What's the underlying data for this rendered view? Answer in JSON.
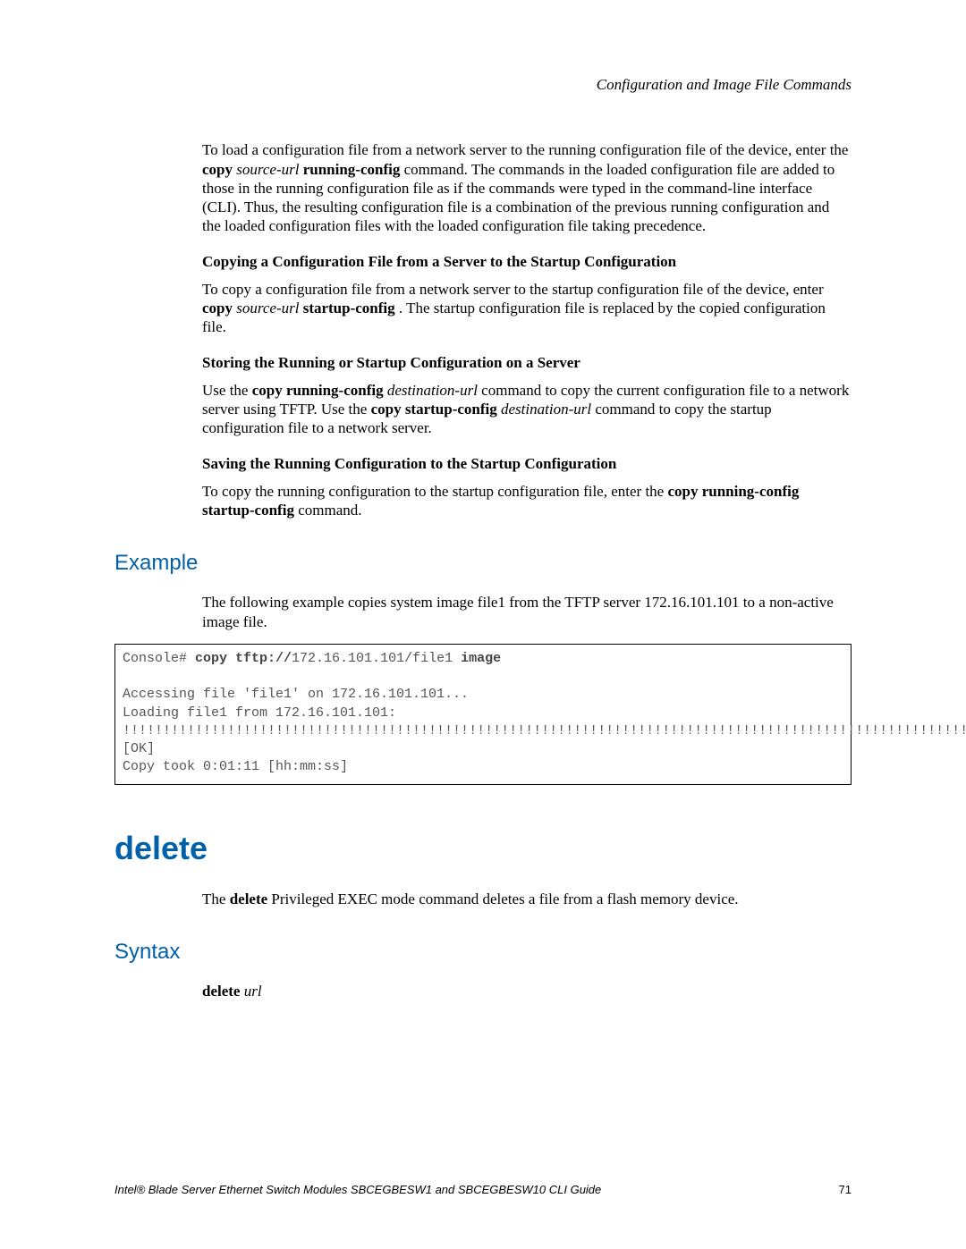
{
  "header": {
    "running_title": "Configuration and Image File Commands"
  },
  "intro_para": {
    "pre": "To load a configuration file from a network server to the running configuration file of the device, enter the ",
    "cmd_bold1": "copy",
    "cmd_ital": "source-url",
    "cmd_bold2": "running-config",
    "post": " command. The commands in the loaded configuration file are added to those in the running configuration file as if the commands were typed in the command-line interface (CLI). Thus, the resulting configuration file is a combination of the previous running configuration and the loaded configuration files with the loaded configuration file taking precedence."
  },
  "sec1": {
    "heading": "Copying a Configuration File from a Server to the Startup Configuration",
    "pre": "To copy a configuration file from a network server to the startup configuration file of the device, enter ",
    "cmd_bold1": "copy",
    "cmd_ital": "source-url",
    "cmd_bold2": "startup-config",
    "post": ". The startup configuration file is replaced by the copied configuration file."
  },
  "sec2": {
    "heading": "Storing the Running or Startup Configuration on a Server",
    "s1_pre": "Use the ",
    "s1_bold": "copy running-config",
    "s1_ital": "destination-url",
    "s1_mid": " command to copy the current configuration file to a network server using TFTP. Use the ",
    "s2_bold": "copy startup-config",
    "s2_ital": "destination-url",
    "s2_post": " command to copy the startup configuration file to a network server."
  },
  "sec3": {
    "heading": "Saving the Running Configuration to the Startup Configuration",
    "pre": "To copy the running configuration to the startup configuration file, enter the ",
    "bold": "copy running-config startup-config",
    "post": " command."
  },
  "example": {
    "heading": "Example",
    "para": "The following example copies system image file1 from the TFTP server 172.16.101.101 to a non-active image file.",
    "code_prompt": "Console# ",
    "code_cmd1": "copy tftp://",
    "code_ip_path": "172.16.101.101/file1 ",
    "code_cmd2": "image",
    "code_body": "\n\nAccessing file 'file1' on 172.16.101.101...\nLoading file1 from 172.16.101.101: !!!!!!!!!!!!!!!!!!!!!!!!!!!!!!!!!!!!!!!!!!!!!!!!!!!!!!!!!!!!!!!!!!!!!!!!!!!!!!!!!!!!!!!!!!!!!!!!!!!!!!!!!!!!!!!!!!!!!!!!!!!!!!!!!!!!!!!!!!!!!!!!!!!!!!!!!!!!!!!!!!!!!!!!!!!!!!!!!!!!!!!!!!!!!!!!!!!!!!!!!!!!!!!!!!!!!!!!!!! [OK]\nCopy took 0:01:11 [hh:mm:ss]"
  },
  "delete": {
    "title": "delete",
    "desc_pre": "The ",
    "desc_bold": "delete",
    "desc_post": " Privileged EXEC mode command deletes a file from a flash memory device.",
    "syntax_heading": "Syntax",
    "syntax_bold": "delete",
    "syntax_ital": "url"
  },
  "footer": {
    "title": "Intel® Blade Server Ethernet Switch Modules SBCEGBESW1 and SBCEGBESW10 CLI Guide",
    "page": "71"
  }
}
